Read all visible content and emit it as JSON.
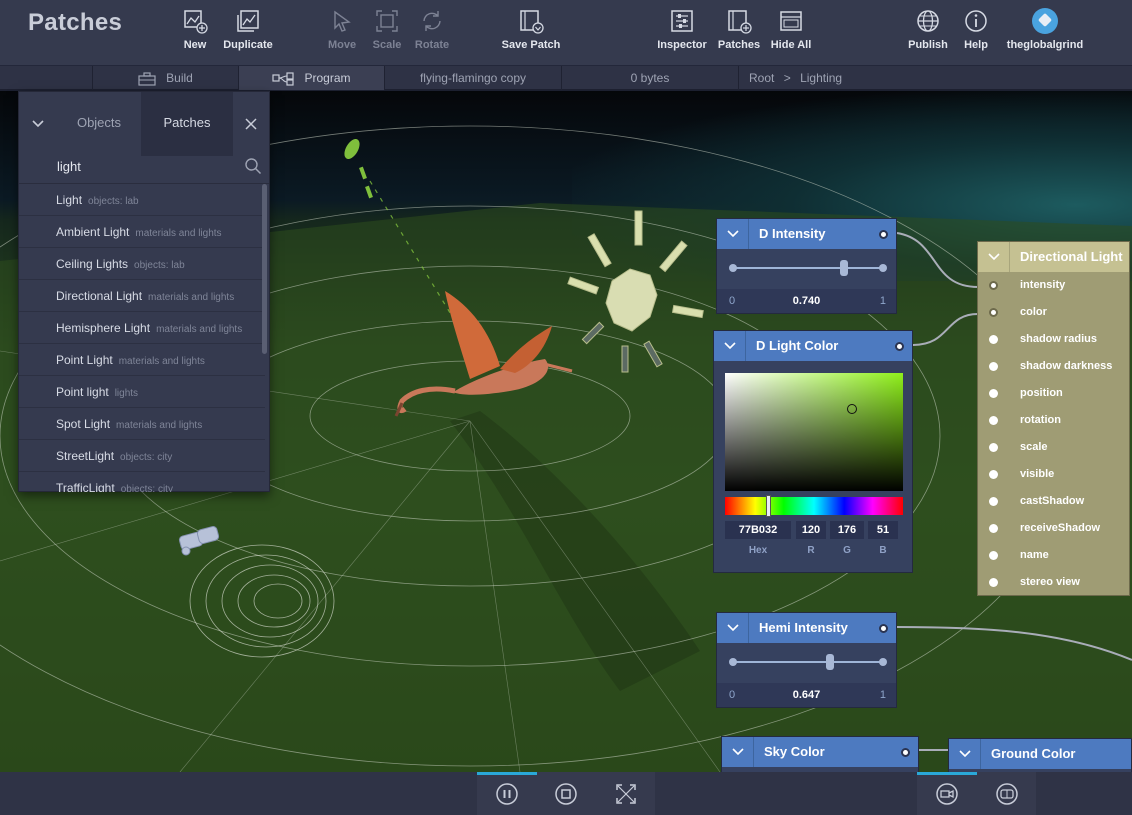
{
  "app": {
    "title": "Patches"
  },
  "toolbar": {
    "new": "New",
    "duplicate": "Duplicate",
    "move": "Move",
    "scale": "Scale",
    "rotate": "Rotate",
    "save_patch": "Save Patch",
    "inspector": "Inspector",
    "patches": "Patches",
    "hide_all": "Hide All",
    "publish": "Publish",
    "help": "Help",
    "user": "theglobalgrind"
  },
  "subbar": {
    "build": "Build",
    "program": "Program",
    "project": "flying-flamingo copy",
    "size": "0 bytes",
    "breadcrumb_root": "Root",
    "breadcrumb_sep": ">",
    "breadcrumb_current": "Lighting"
  },
  "panel": {
    "tab_objects": "Objects",
    "tab_patches": "Patches",
    "search_value": "light",
    "items": [
      {
        "name": "Light",
        "category": "objects: lab"
      },
      {
        "name": "Ambient Light",
        "category": "materials and lights"
      },
      {
        "name": "Ceiling Lights",
        "category": "objects: lab"
      },
      {
        "name": "Directional Light",
        "category": "materials and lights"
      },
      {
        "name": "Hemisphere Light",
        "category": "materials and lights"
      },
      {
        "name": "Point Light",
        "category": "materials and lights"
      },
      {
        "name": "Point light",
        "category": "lights"
      },
      {
        "name": "Spot Light",
        "category": "materials and lights"
      },
      {
        "name": "StreetLight",
        "category": "objects: city"
      },
      {
        "name": "TrafficLight",
        "category": "objects: city"
      }
    ]
  },
  "nodes": {
    "d_intensity": {
      "title": "D Intensity",
      "min": "0",
      "max": "1",
      "value": "0.740",
      "level": 0.74
    },
    "d_light_color": {
      "title": "D Light Color",
      "hex": "77B032",
      "r": "120",
      "g": "176",
      "b": "51",
      "label_hex": "Hex",
      "label_r": "R",
      "label_g": "G",
      "label_b": "B"
    },
    "hemi_intensity": {
      "title": "Hemi Intensity",
      "min": "0",
      "max": "1",
      "value": "0.647",
      "level": 0.647
    },
    "sky_color": {
      "title": "Sky Color"
    },
    "ground_color": {
      "title": "Ground Color"
    },
    "directional_light": {
      "title": "Directional Light",
      "ports": [
        "intensity",
        "color",
        "shadow radius",
        "shadow darkness",
        "position",
        "rotation",
        "scale",
        "visible",
        "castShadow",
        "receiveShadow",
        "name",
        "stereo view"
      ]
    }
  }
}
